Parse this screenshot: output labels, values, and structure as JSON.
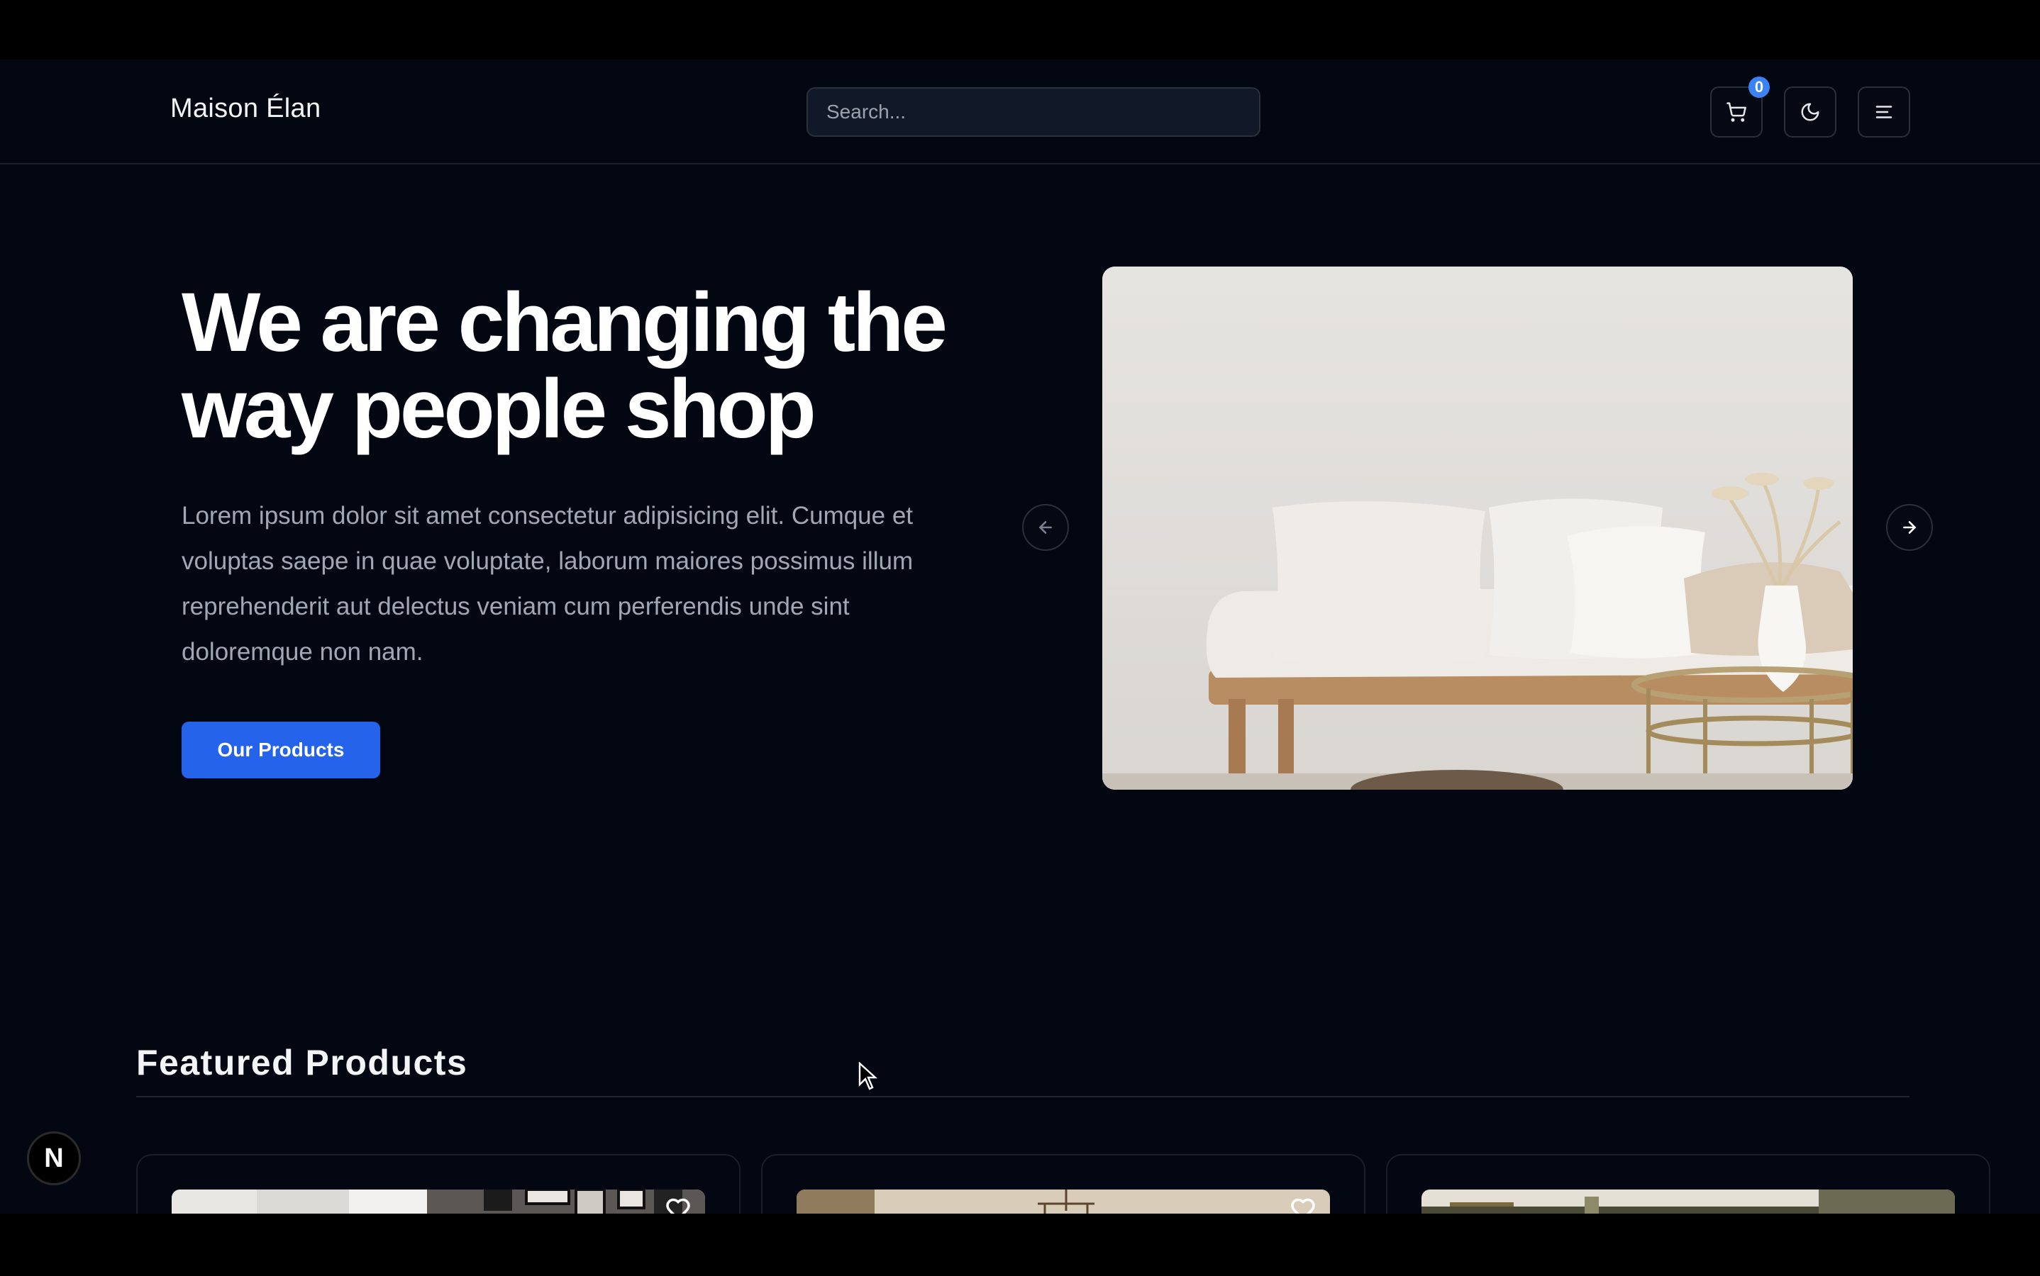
{
  "header": {
    "brand": "Maison Élan",
    "search_placeholder": "Search...",
    "cart_count": "0",
    "cart_icon": "cart-icon",
    "theme_icon": "moon-icon",
    "menu_icon": "menu-icon"
  },
  "hero": {
    "title": "We are changing the way people shop",
    "body": "Lorem ipsum dolor sit amet consectetur adipisicing elit. Cumque et voluptas saepe in quae voluptate, laborum maiores possimus illum reprehenderit aut delectus veniam cum perferendis unde sint doloremque non nam.",
    "cta_label": "Our Products",
    "prev_icon": "arrow-left-icon",
    "next_icon": "arrow-right-icon",
    "slide_description": "sofa-photo"
  },
  "featured": {
    "title": "Featured Products",
    "cards": [
      {
        "image": "gallery-wall-photo",
        "favorite_icon": "heart-icon"
      },
      {
        "image": "chandelier-room-photo",
        "favorite_icon": "heart-icon"
      },
      {
        "image": "dining-room-photo",
        "favorite_icon": "heart-icon"
      }
    ]
  },
  "dev_badge": "N",
  "colors": {
    "background": "#030712",
    "accent": "#2563eb",
    "badge": "#3b82f6",
    "text": "#ffffff",
    "muted_text": "#a1a7b3"
  }
}
